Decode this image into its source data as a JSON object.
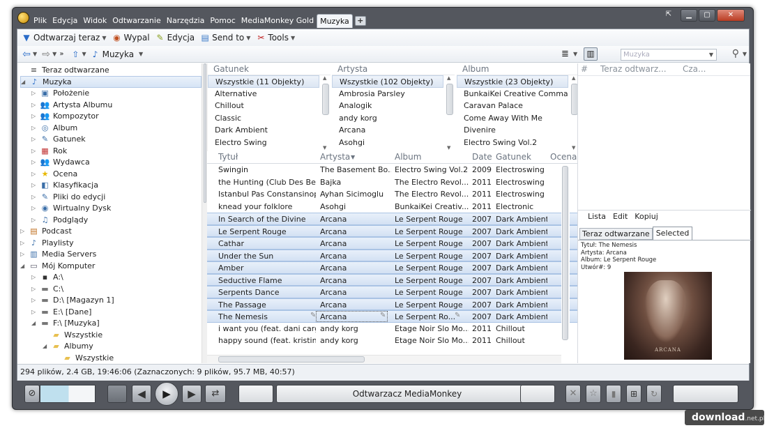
{
  "menu": [
    "Plik",
    "Edycja",
    "Widok",
    "Odtwarzanie",
    "Narzędzia",
    "Pomoc",
    "MediaMonkey Gold"
  ],
  "active_tab": "Muzyka",
  "toolbar1": {
    "play_now": "Odtwarzaj teraz",
    "burn": "Wypal",
    "edit": "Edycja",
    "send_to": "Send to",
    "tools": "Tools"
  },
  "toolbar2": {
    "location": "Muzyka",
    "search_placeholder": "Muzyka"
  },
  "tree": [
    {
      "label": "Teraz odtwarzane",
      "level": 1,
      "icon": "now-playing-icon",
      "glyph": "≡",
      "exp": ""
    },
    {
      "label": "Muzyka",
      "level": 1,
      "icon": "music-note-icon",
      "glyph": "♪",
      "exp": "◢",
      "sel": true
    },
    {
      "label": "Położenie",
      "level": 2,
      "icon": "location-icon",
      "glyph": "▣",
      "exp": "▷"
    },
    {
      "label": "Artysta Albumu",
      "level": 2,
      "icon": "album-artist-icon",
      "glyph": "👥",
      "exp": "▷"
    },
    {
      "label": "Kompozytor",
      "level": 2,
      "icon": "composer-icon",
      "glyph": "👥",
      "exp": "▷"
    },
    {
      "label": "Album",
      "level": 2,
      "icon": "album-icon",
      "glyph": "◎",
      "exp": "▷"
    },
    {
      "label": "Gatunek",
      "level": 2,
      "icon": "genre-icon",
      "glyph": "✎",
      "exp": "▷"
    },
    {
      "label": "Rok",
      "level": 2,
      "icon": "calendar-icon",
      "glyph": "▦",
      "exp": "▷"
    },
    {
      "label": "Wydawca",
      "level": 2,
      "icon": "publisher-icon",
      "glyph": "👥",
      "exp": "▷"
    },
    {
      "label": "Ocena",
      "level": 2,
      "icon": "star-icon",
      "glyph": "★",
      "exp": "▷"
    },
    {
      "label": "Klasyfikacja",
      "level": 2,
      "icon": "classification-icon",
      "glyph": "◧",
      "exp": "▷"
    },
    {
      "label": "Pliki do edycji",
      "level": 2,
      "icon": "files-to-edit-icon",
      "glyph": "✎",
      "exp": "▷"
    },
    {
      "label": "Wirtualny Dysk",
      "level": 2,
      "icon": "virtual-disk-icon",
      "glyph": "◉",
      "exp": "▷"
    },
    {
      "label": "Podglądy",
      "level": 2,
      "icon": "preview-icon",
      "glyph": "♫",
      "exp": "▷"
    },
    {
      "label": "Podcast",
      "level": 1,
      "icon": "podcast-icon",
      "glyph": "▤",
      "exp": "▷"
    },
    {
      "label": "Playlisty",
      "level": 1,
      "icon": "playlist-icon",
      "glyph": "♪",
      "exp": "▷"
    },
    {
      "label": "Media Servers",
      "level": 1,
      "icon": "media-server-icon",
      "glyph": "▥",
      "exp": "▷"
    },
    {
      "label": "Mój Komputer",
      "level": 1,
      "icon": "computer-icon",
      "glyph": "▭",
      "exp": "◢"
    },
    {
      "label": "A:\\",
      "level": 2,
      "icon": "floppy-icon",
      "glyph": "▪",
      "exp": "▷"
    },
    {
      "label": "C:\\",
      "level": 2,
      "icon": "drive-icon",
      "glyph": "▬",
      "exp": "▷"
    },
    {
      "label": "D:\\ [Magazyn 1]",
      "level": 2,
      "icon": "drive-icon",
      "glyph": "▬",
      "exp": "▷"
    },
    {
      "label": "E:\\ [Dane]",
      "level": 2,
      "icon": "drive-icon",
      "glyph": "▬",
      "exp": "▷"
    },
    {
      "label": "F:\\ [Muzyka]",
      "level": 2,
      "icon": "drive-icon",
      "glyph": "▬",
      "exp": "◢"
    },
    {
      "label": "Wszystkie",
      "level": 3,
      "icon": "folder-icon",
      "glyph": "▰",
      "exp": ""
    },
    {
      "label": "Albumy",
      "level": 3,
      "icon": "folder-icon",
      "glyph": "▰",
      "exp": "◢"
    },
    {
      "label": "Wszystkie",
      "level": 4,
      "icon": "folder-icon",
      "glyph": "▰",
      "exp": ""
    }
  ],
  "filters": [
    {
      "header": "Gatunek",
      "items": [
        "Wszystkie (11 Objekty)",
        "Alternative",
        "Chillout",
        "Classic",
        "Dark Ambient",
        "Electro Swing"
      ]
    },
    {
      "header": "Artysta",
      "items": [
        "Wszystkie (102 Objekty)",
        "Ambrosia Parsley",
        "Analogik",
        "andy korg",
        "Arcana",
        "Asohgi"
      ]
    },
    {
      "header": "Album",
      "items": [
        "Wszystkie (23 Objekty)",
        "BunkaiKei Creative Comman...",
        "Caravan Palace",
        "Come Away With Me",
        "Divenire",
        "Electro Swing Vol.2"
      ]
    }
  ],
  "track_headers": [
    "Tytuł",
    "Artysta",
    "Album",
    "Date",
    "Gatunek",
    "Ocena"
  ],
  "tracks": [
    [
      "Swingin",
      "The Basement Bo...",
      "Electro Swing Vol.2",
      "2009",
      "Electroswing",
      false
    ],
    [
      "the Hunting (Club Des Bel...",
      "Bajka",
      "The Electro Revol...",
      "2011",
      "Electroswing",
      false
    ],
    [
      "Istanbul Pas Constansinople",
      "Ayhan Sicimoglu",
      "The Electro Revol...",
      "2011",
      "Electroswing",
      false
    ],
    [
      "knead your folklore",
      "Asohgi",
      "BunkaiKei Creativ...",
      "2011",
      "Electronic",
      false
    ],
    [
      "In Search of the Divine",
      "Arcana",
      "Le Serpent Rouge",
      "2007",
      "Dark Ambient",
      true
    ],
    [
      "Le Serpent Rouge",
      "Arcana",
      "Le Serpent Rouge",
      "2007",
      "Dark Ambient",
      true
    ],
    [
      "Cathar",
      "Arcana",
      "Le Serpent Rouge",
      "2007",
      "Dark Ambient",
      true
    ],
    [
      "Under the Sun",
      "Arcana",
      "Le Serpent Rouge",
      "2007",
      "Dark Ambient",
      true
    ],
    [
      "Amber",
      "Arcana",
      "Le Serpent Rouge",
      "2007",
      "Dark Ambient",
      true
    ],
    [
      "Seductive Flame",
      "Arcana",
      "Le Serpent Rouge",
      "2007",
      "Dark Ambient",
      true
    ],
    [
      "Serpents Dance",
      "Arcana",
      "Le Serpent Rouge",
      "2007",
      "Dark Ambient",
      true
    ],
    [
      "The Passage",
      "Arcana",
      "Le Serpent Rouge",
      "2007",
      "Dark Ambient",
      true
    ],
    [
      "The Nemesis",
      "Arcana",
      "Le Serpent Ro...",
      "2007",
      "Dark Ambient",
      true
    ],
    [
      "i want you (feat. dani cargo)",
      "andy korg",
      "Etage Noir Slo Mo...",
      "2011",
      "Chillout",
      false
    ],
    [
      "happy sound (feat. kristin...",
      "andy korg",
      "Etage Noir Slo Mo...",
      "2011",
      "Chillout",
      false
    ]
  ],
  "now_playing": {
    "headers": [
      "#",
      "Teraz odtwarz...",
      "Cza..."
    ],
    "menu": [
      "Lista",
      "Edit",
      "Kopiuj"
    ],
    "tabs": [
      "Teraz odtwarzane",
      "Selected"
    ],
    "info": [
      "Tytuł: The Nemesis",
      "Artysta: Arcana",
      "Album: Le Serpent Rouge",
      "Utwór#: 9"
    ],
    "cover_text": "ARCANA"
  },
  "status": "294 plików, 2.4 GB, 19:46:06 (Zaznaczonych: 9 plików, 95.7 MB, 40:57)",
  "player": {
    "title": "Odtwarzacz MediaMonkey"
  },
  "watermark": {
    "main": "download",
    "suffix": ".net.pl"
  }
}
